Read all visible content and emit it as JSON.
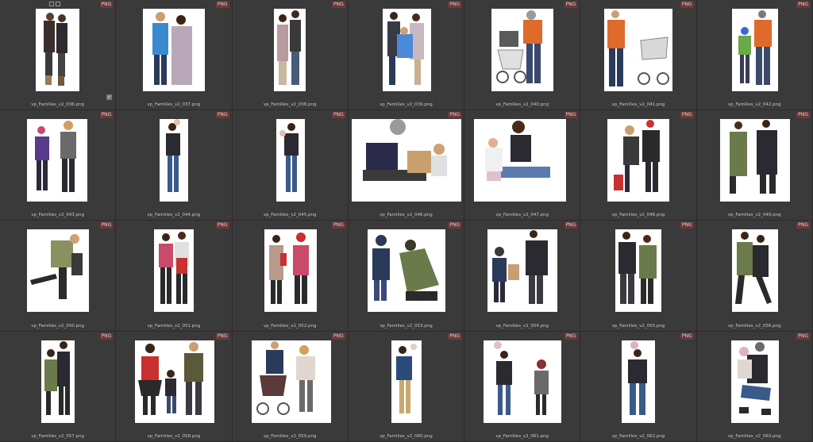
{
  "badge_label": "PNG",
  "items": [
    {
      "file": "vp_Families_v2_036.png"
    },
    {
      "file": "vp_Families_v2_037.png"
    },
    {
      "file": "vp_Families_v2_038.png"
    },
    {
      "file": "vp_Families_v2_039.png"
    },
    {
      "file": "vp_Families_v2_040.png"
    },
    {
      "file": "vp_Families_v2_041.png"
    },
    {
      "file": "vp_Families_v2_042.png"
    },
    {
      "file": "vp_Families_v2_043.png"
    },
    {
      "file": "vp_Families_v2_044.png"
    },
    {
      "file": "vp_Families_v2_045.png"
    },
    {
      "file": "vp_Families_v2_046.png"
    },
    {
      "file": "vp_Families_v2_047.png"
    },
    {
      "file": "vp_Families_v2_048.png"
    },
    {
      "file": "vp_Families_v2_049.png"
    },
    {
      "file": "vp_Families_v2_050.png"
    },
    {
      "file": "vp_Families_v2_051.png"
    },
    {
      "file": "vp_Families_v2_052.png"
    },
    {
      "file": "vp_Families_v2_053.png"
    },
    {
      "file": "vp_Families_v2_054.png"
    },
    {
      "file": "vp_Families_v2_055.png"
    },
    {
      "file": "vp_Families_v2_056.png"
    },
    {
      "file": "vp_Families_v2_057.png"
    },
    {
      "file": "vp_Families_v2_058.png"
    },
    {
      "file": "vp_Families_v2_059.png"
    },
    {
      "file": "vp_Families_v2_060.png"
    },
    {
      "file": "vp_Families_v2_061.png"
    },
    {
      "file": "vp_Families_v2_062.png"
    },
    {
      "file": "vp_Families_v2_063.png"
    }
  ],
  "colors": {
    "background": "#2b2b2b",
    "tile": "#3a3a3a",
    "badge": "#6a3a3a"
  }
}
